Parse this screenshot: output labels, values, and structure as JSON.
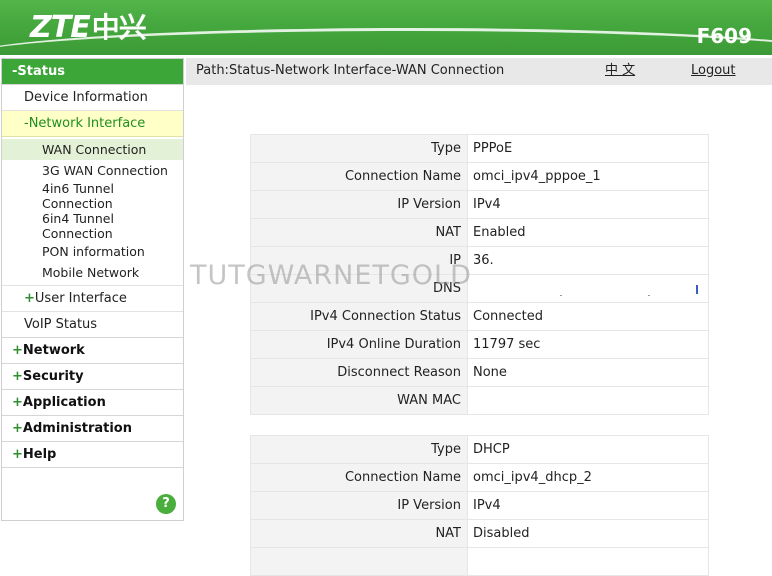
{
  "header": {
    "brand": "ZTE",
    "brand_cn": "中兴",
    "model": "F609"
  },
  "pathbar": {
    "path": "Path:Status-Network Interface-WAN Connection",
    "lang": "中 文",
    "logout": "Logout"
  },
  "watermark": "TUTGWARNETGOLD",
  "sidebar": {
    "status": "-Status",
    "device_information": "Device Information",
    "network_interface": "-Network Interface",
    "wan_connection": "WAN Connection",
    "wan3g": "3G WAN Connection",
    "tunnel_4in6_a": "4in6 Tunnel",
    "tunnel_4in6_b": "Connection",
    "tunnel_6in4_a": "6in4 Tunnel",
    "tunnel_6in4_b": "Connection",
    "pon_information": "PON information",
    "mobile_network": "Mobile Network",
    "user_interface": "User Interface",
    "voip_status": "VoIP Status",
    "network": "Network",
    "security": "Security",
    "application": "Application",
    "administration": "Administration",
    "help": "Help",
    "plus": "+",
    "help_icon": "?"
  },
  "conn1": {
    "labels": [
      "Type",
      "Connection Name",
      "IP Version",
      "NAT",
      "IP",
      "DNS",
      "IPv4 Connection Status",
      "IPv4 Online Duration",
      "Disconnect Reason",
      "WAN MAC"
    ],
    "values": [
      "PPPoE",
      "omci_ipv4_pppoe_1",
      "IPv4",
      "Enabled",
      "36.",
      "",
      "Connected",
      "11797 sec",
      "None",
      ""
    ]
  },
  "conn2": {
    "labels": [
      "Type",
      "Connection Name",
      "IP Version",
      "NAT"
    ],
    "values": [
      "DHCP",
      "omci_ipv4_dhcp_2",
      "IPv4",
      "Disabled"
    ]
  }
}
